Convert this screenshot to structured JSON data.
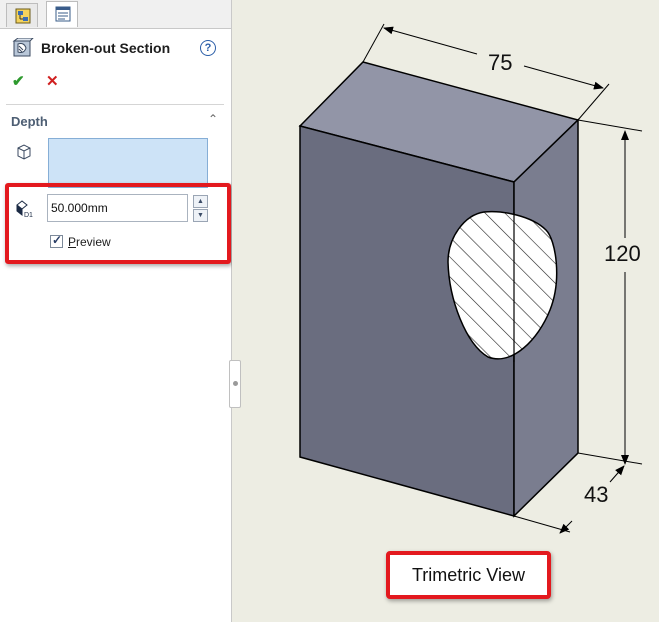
{
  "tabs": [
    {
      "name": "feature-manager-tab"
    },
    {
      "name": "property-manager-tab",
      "active": true
    }
  ],
  "property_manager": {
    "title": "Broken-out Section",
    "help_label": "?",
    "ok_label": "✔",
    "cancel_label": "✕"
  },
  "depth_group": {
    "title": "Depth",
    "collapse_label": "⌃",
    "depth_value": "50.000mm",
    "spin_up": "▲",
    "spin_down": "▼",
    "preview_checked": true,
    "preview_label_underlined": "P",
    "preview_label_rest": "review"
  },
  "viewport": {
    "dimensions": {
      "width": "75",
      "height": "120",
      "depth": "43"
    },
    "view_label": "Trimetric View"
  },
  "colors": {
    "highlight": "#e3191e",
    "box_front": "#6a6d7f",
    "box_top": "#9295a7",
    "box_side": "#7a7d8f",
    "background": "#edede3"
  }
}
